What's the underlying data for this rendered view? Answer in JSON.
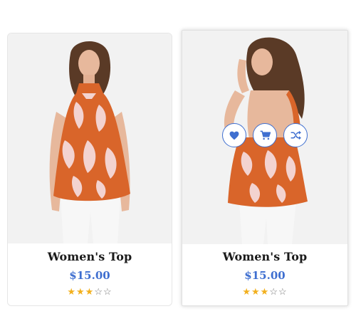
{
  "products": [
    {
      "name": "Women's Top",
      "price": "$15.00",
      "rating": 3,
      "rating_max": 5
    },
    {
      "name": "Women's Top",
      "price": "$15.00",
      "rating": 3,
      "rating_max": 5,
      "actions": [
        "heart-icon",
        "cart-icon",
        "shuffle-icon"
      ]
    }
  ],
  "colors": {
    "accent": "#3f6fd0",
    "star": "#f2b01e",
    "top_orange": "#d9652a",
    "top_pink": "#f3d3d0"
  }
}
